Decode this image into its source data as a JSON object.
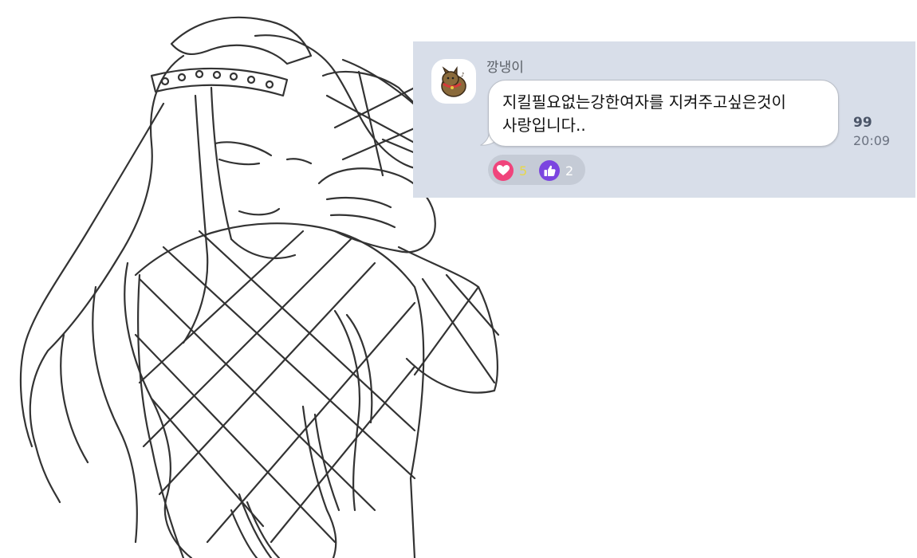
{
  "message": {
    "sender": "깡냉이",
    "text_line1": "지킬필요없는강한여자를 지켜주고싶은것이",
    "text_line2": "사랑입니다..",
    "read_count": "99",
    "time": "20:09"
  },
  "reactions": [
    {
      "icon": "heart-icon",
      "color": "#f0447c",
      "count": "5",
      "count_color": "#e8d84a"
    },
    {
      "icon": "thumbs-up-icon",
      "color": "#7b45e0",
      "count": "2",
      "count_color": "#ffffff"
    }
  ],
  "colors": {
    "panel_bg": "#d8dee9",
    "bubble_bg": "#ffffff",
    "reaction_pill_bg": "#c5cbd6"
  }
}
